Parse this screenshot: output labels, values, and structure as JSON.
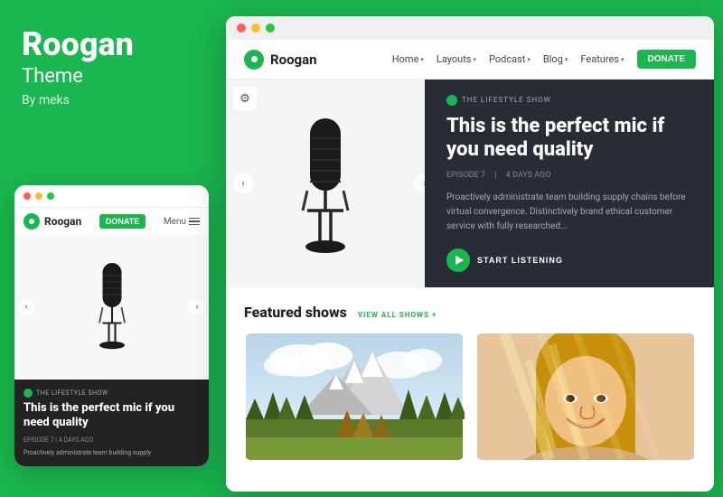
{
  "brand": {
    "name": "Roogan",
    "subtitle": "Theme",
    "by": "By meks"
  },
  "mobile": {
    "dots": [
      "red",
      "yellow",
      "green"
    ],
    "logo_text": "Roogan",
    "donate_label": "DONATE",
    "menu_label": "Menu",
    "show_label": "THE LIFESTYLE SHOW",
    "headline": "This is the perfect mic if you need quality",
    "meta": "EPISODE 7  |  4 DAYS AGO",
    "desc": "Proactively administrate team building supply"
  },
  "desktop": {
    "window_dots": [
      "red",
      "yellow",
      "green"
    ],
    "nav": {
      "logo_text": "Roogan",
      "links": [
        {
          "label": "Home",
          "has_chevron": true
        },
        {
          "label": "Layouts",
          "has_chevron": true
        },
        {
          "label": "Podcast",
          "has_chevron": true
        },
        {
          "label": "Blog",
          "has_chevron": true
        },
        {
          "label": "Features",
          "has_chevron": true
        }
      ],
      "donate_label": "DONATE"
    },
    "hero": {
      "show_label": "THE LIFESTYLE SHOW",
      "headline": "This is the perfect mic if you need quality",
      "episode": "EPISODE 7",
      "days_ago": "4 DAYS AGO",
      "desc": "Proactively administrate team building supply chains before virtual convergence. Distinctively brand ethical customer service with fully researched...",
      "cta_label": "START LISTENING"
    },
    "featured": {
      "title": "Featured shows",
      "view_all": "VIEW ALL SHOWS +"
    }
  }
}
